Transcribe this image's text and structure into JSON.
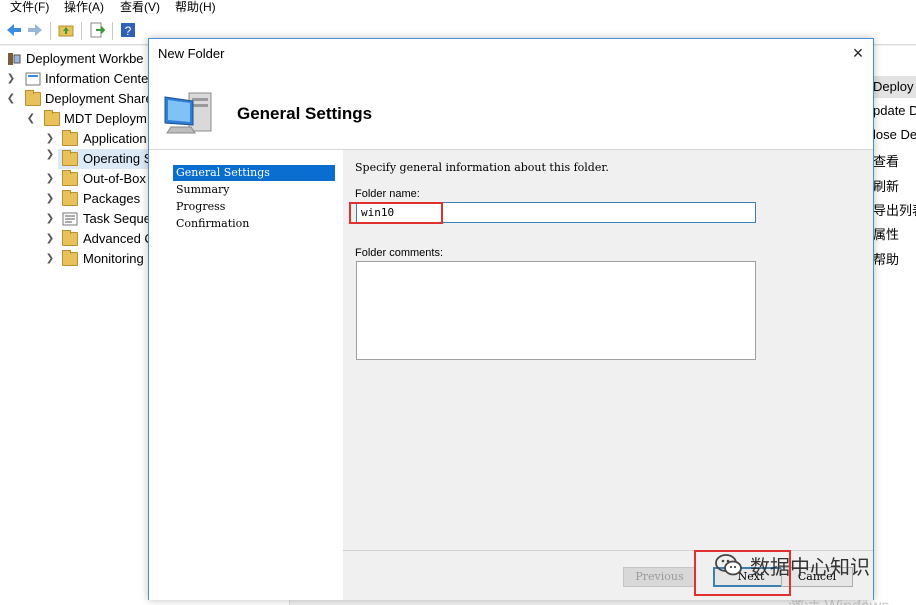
{
  "menu": {
    "file": "文件(F)",
    "action": "操作(A)",
    "view": "查看(V)",
    "help": "帮助(H)"
  },
  "tree": {
    "items": [
      {
        "label": "Deployment Workbe"
      },
      {
        "label": "Information Cente"
      },
      {
        "label": "Deployment Share"
      },
      {
        "label": "MDT Deploym"
      },
      {
        "label": "Application"
      },
      {
        "label": "Operating S"
      },
      {
        "label": "Out-of-Box"
      },
      {
        "label": "Packages"
      },
      {
        "label": "Task Seque"
      },
      {
        "label": "Advanced C"
      },
      {
        "label": "Monitoring"
      }
    ]
  },
  "actions": {
    "items": [
      {
        "label": "Deploy"
      },
      {
        "label": "pdate D"
      },
      {
        "label": "lose De"
      },
      {
        "label": "查看"
      },
      {
        "label": "刷新"
      },
      {
        "label": "导出列表..."
      },
      {
        "label": "属性"
      },
      {
        "label": "帮助"
      }
    ]
  },
  "bg_watermark": "激活 Windows",
  "dialog": {
    "title": "New Folder",
    "close": "×",
    "header_title": "General Settings",
    "nav": [
      {
        "label": "General Settings",
        "active": true
      },
      {
        "label": "Summary",
        "active": false
      },
      {
        "label": "Progress",
        "active": false
      },
      {
        "label": "Confirmation",
        "active": false
      }
    ],
    "intro": "Specify general information about this folder.",
    "folder_name_label": "Folder name:",
    "folder_name_value": "win10",
    "folder_comments_label": "Folder comments:",
    "folder_comments_value": "",
    "buttons": {
      "previous": "Previous",
      "next": "Next",
      "cancel": "Cancel"
    }
  },
  "watermark": {
    "text": "数据中心知识"
  },
  "colors": {
    "accent": "#0a6ed1",
    "highlight": "#e0312f",
    "focus_border": "#3c7fb1"
  }
}
